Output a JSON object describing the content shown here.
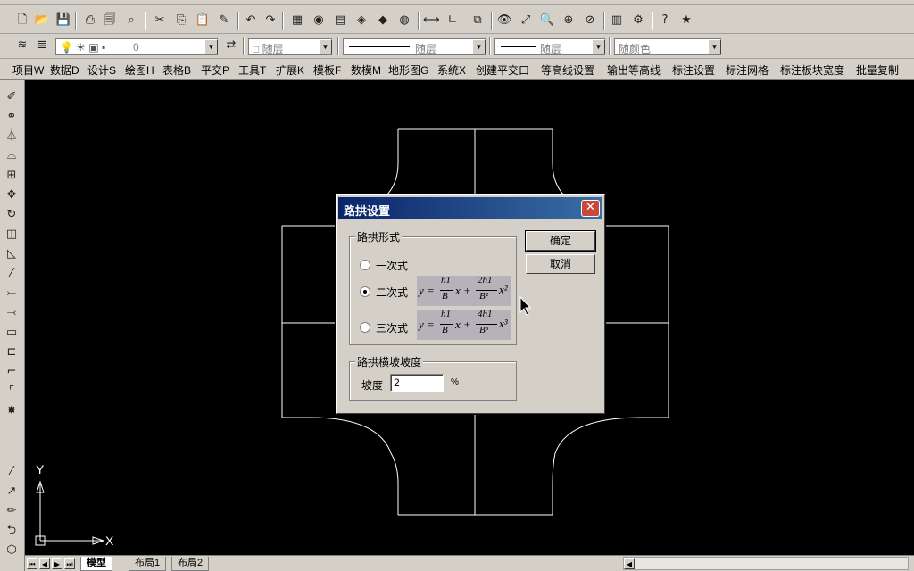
{
  "toolbar_standard": {
    "icons": [
      "new-icon",
      "open-icon",
      "save-icon",
      "print-icon",
      "print-preview-icon",
      "plot-icon",
      "cut-icon",
      "copy-icon",
      "paste-icon",
      "match-properties-icon",
      "undo-icon",
      "redo-icon",
      "properties-icon",
      "designcenter-icon",
      "tool-palette-icon",
      "sheetset-icon",
      "markup-icon",
      "distance-icon",
      "coordinate-icon",
      "zoom-window-icon",
      "pan-icon",
      "zoom-realtime-icon",
      "zoom-previous-icon",
      "toolbar-icon",
      "sheet-icon",
      "help-icon",
      "highlight-icon"
    ]
  },
  "layers_toolbar": {
    "layer_value": "0",
    "color_value": "随层",
    "linetype_value": "随层",
    "lineweight_value": "随层",
    "plotstyle_value": "随颜色"
  },
  "menu": {
    "items": [
      "项目W",
      "数据D",
      "设计S",
      "绘图H",
      "表格B",
      "平交P",
      "工具T",
      "扩展K",
      "模板F",
      "数模M",
      "地形图G",
      "系统X",
      "创建平交口",
      "等高线设置",
      "输出等高线",
      "标注设置",
      "标注网格",
      "标注板块宽度",
      "批量复制"
    ]
  },
  "bottom": {
    "tabs": [
      "模型",
      "布局1",
      "布局2"
    ],
    "active_tab": "模型",
    "ucs_x": "X",
    "ucs_y": "Y"
  },
  "dialog": {
    "title": "路拱设置",
    "close_symbol": "✕",
    "ok_label": "确定",
    "cancel_label": "取消",
    "group_form_label": "路拱形式",
    "options": [
      {
        "label": "一次式",
        "checked": false
      },
      {
        "label": "二次式",
        "checked": true
      },
      {
        "label": "三次式",
        "checked": false
      }
    ],
    "formula_quadratic": {
      "lhs": "y =",
      "num1": "h1",
      "den1": "B",
      "mid": "x +",
      "num2": "2h1",
      "den2": "B²",
      "tail": "x²"
    },
    "formula_cubic": {
      "lhs": "y =",
      "num1": "h1",
      "den1": "B",
      "mid": "x +",
      "num2": "4h1",
      "den2": "B³",
      "tail": "x³"
    },
    "group_slope_label": "路拱横坡坡度",
    "slope_label": "坡度",
    "slope_value": "2",
    "slope_unit": "%"
  }
}
